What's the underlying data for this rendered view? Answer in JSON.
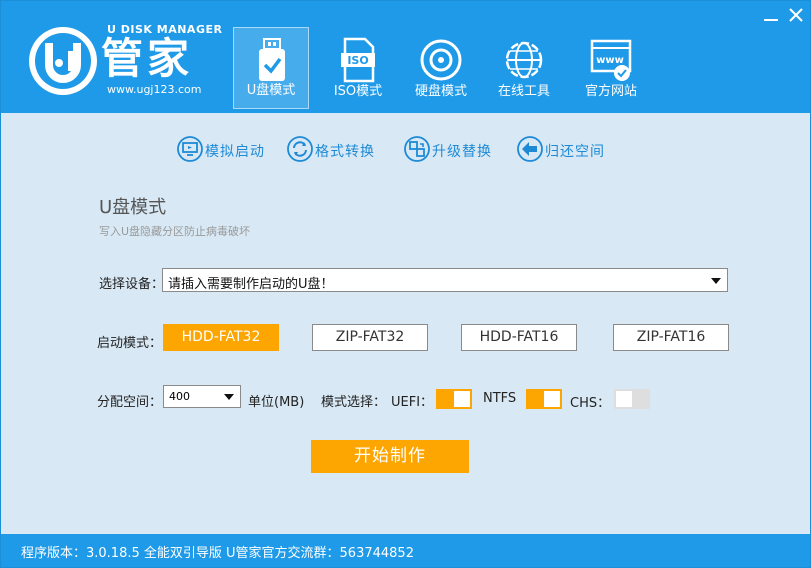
{
  "brand": {
    "name_en": "U DISK MANAGER",
    "name_cn": "管家",
    "url": "www.ugj123.com",
    "accent_color": "#1e9ae8",
    "highlight_color": "#fda500"
  },
  "nav": [
    {
      "label": "U盘模式",
      "icon": "usb-drive-icon",
      "active": true
    },
    {
      "label": "ISO模式",
      "icon": "iso-file-icon",
      "active": false
    },
    {
      "label": "硬盘模式",
      "icon": "hard-disk-icon",
      "active": false
    },
    {
      "label": "在线工具",
      "icon": "globe-icon",
      "active": false
    },
    {
      "label": "官方网站",
      "icon": "website-icon",
      "active": false
    }
  ],
  "tools": [
    {
      "label": "模拟启动",
      "icon": "monitor-icon"
    },
    {
      "label": "格式转换",
      "icon": "refresh-icon"
    },
    {
      "label": "升级替换",
      "icon": "upgrade-icon"
    },
    {
      "label": "归还空间",
      "icon": "back-arrow-icon"
    }
  ],
  "section": {
    "title": "U盘模式",
    "subtitle": "写入U盘隐藏分区防止病毒破坏"
  },
  "device": {
    "label": "选择设备：",
    "value": "请插入需要制作启动的U盘！"
  },
  "boot_mode": {
    "label": "启动模式：",
    "options": [
      "HDD-FAT32",
      "ZIP-FAT32",
      "HDD-FAT16",
      "ZIP-FAT16"
    ],
    "selected": "HDD-FAT32"
  },
  "space": {
    "label": "分配空间：",
    "value": "400",
    "unit": "单位(MB)"
  },
  "mode_select": {
    "label": "模式选择：",
    "uefi_label": "UEFI：",
    "uefi_on": true,
    "ntfs_label": "NTFS",
    "ntfs_on": true,
    "chs_label": "CHS：",
    "chs_on": false
  },
  "start_button": "开始制作",
  "status_bar": "程序版本：3.0.18.5 全能双引导版 U管家官方交流群：563744852"
}
